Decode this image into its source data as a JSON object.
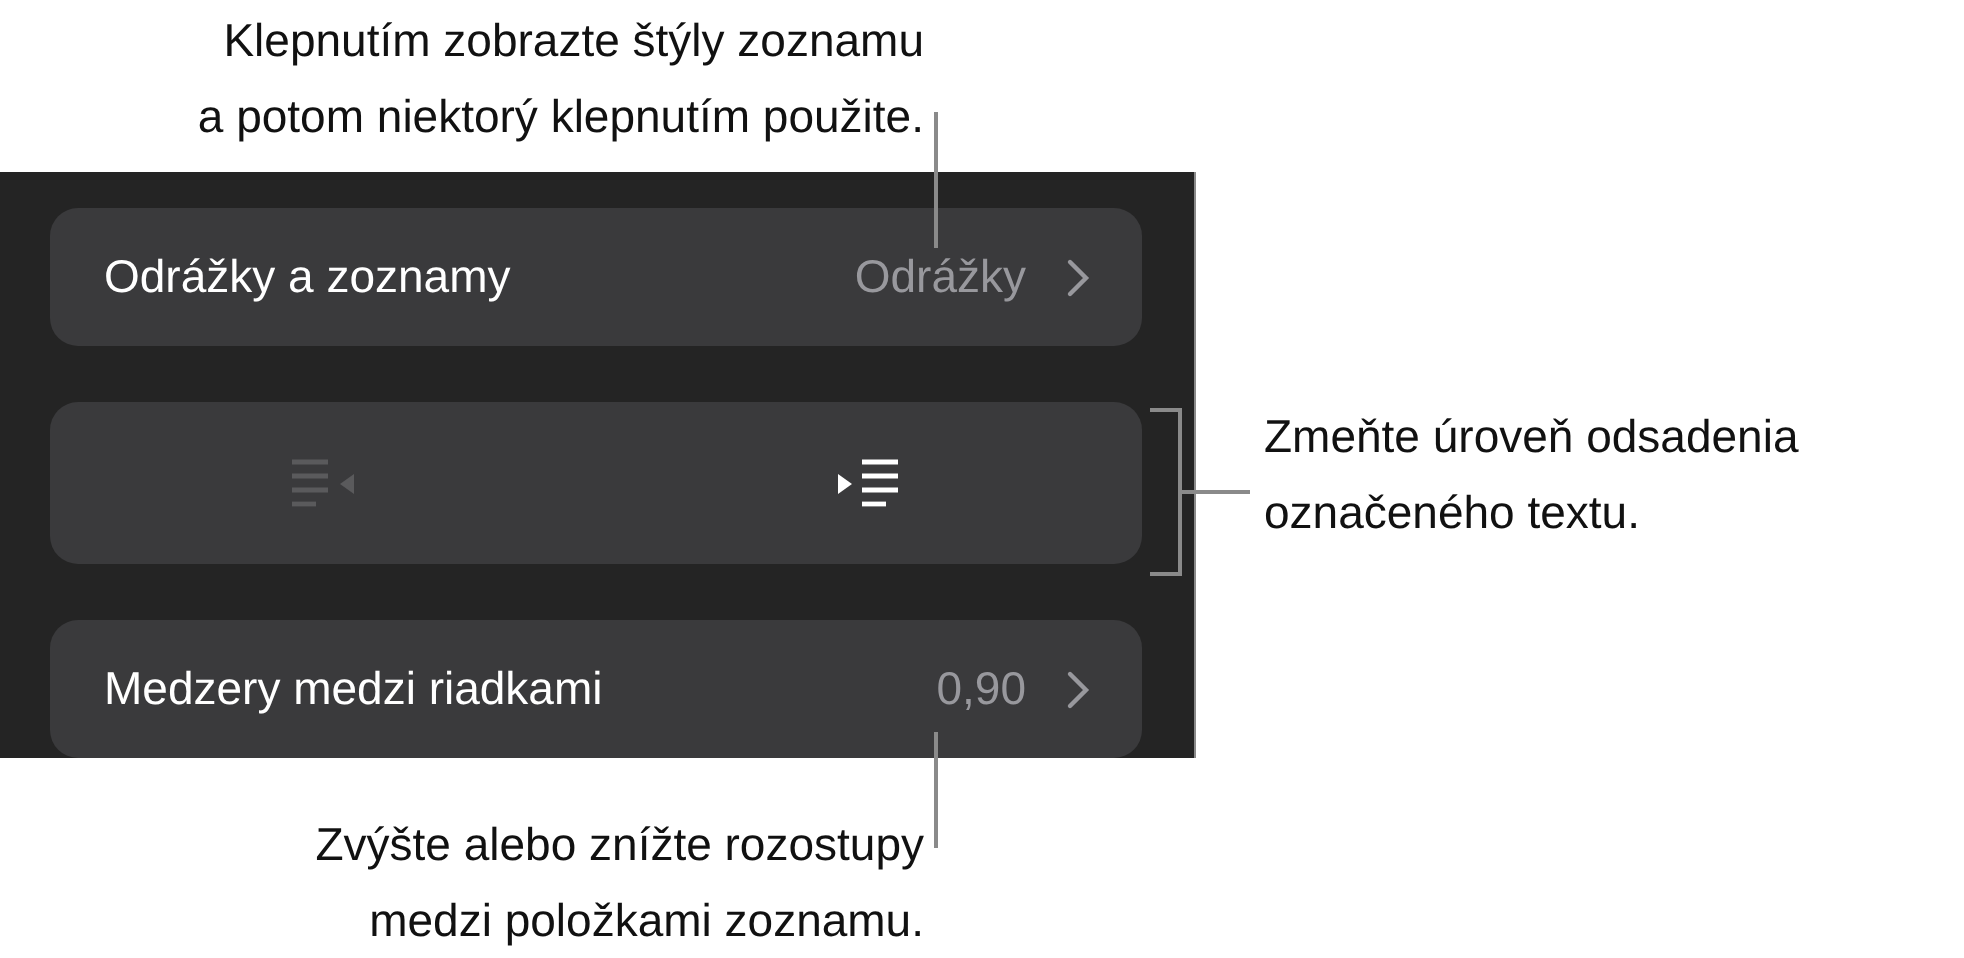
{
  "callouts": [
    {
      "kind": "top",
      "lines": [
        "Klepnutím zobrazte štýly zoznamu",
        "a potom niektorý klepnutím použite."
      ]
    },
    {
      "kind": "right",
      "lines": [
        "Zmeňte úroveň odsadenia",
        "označeného textu."
      ]
    },
    {
      "kind": "bottom",
      "lines": [
        "Zvýšte alebo znížte rozostupy",
        "medzi položkami zoznamu."
      ]
    }
  ],
  "panel": {
    "rows": [
      {
        "kind": "disclosure",
        "label": "Odrážky a zoznamy",
        "value": "Odrážky"
      },
      {
        "kind": "indent",
        "buttons": [
          {
            "kind": "outdent",
            "disabled": true
          },
          {
            "kind": "indent",
            "disabled": false
          }
        ]
      },
      {
        "kind": "disclosure",
        "label": "Medzery medzi riadkami",
        "value": "0,90"
      }
    ]
  }
}
